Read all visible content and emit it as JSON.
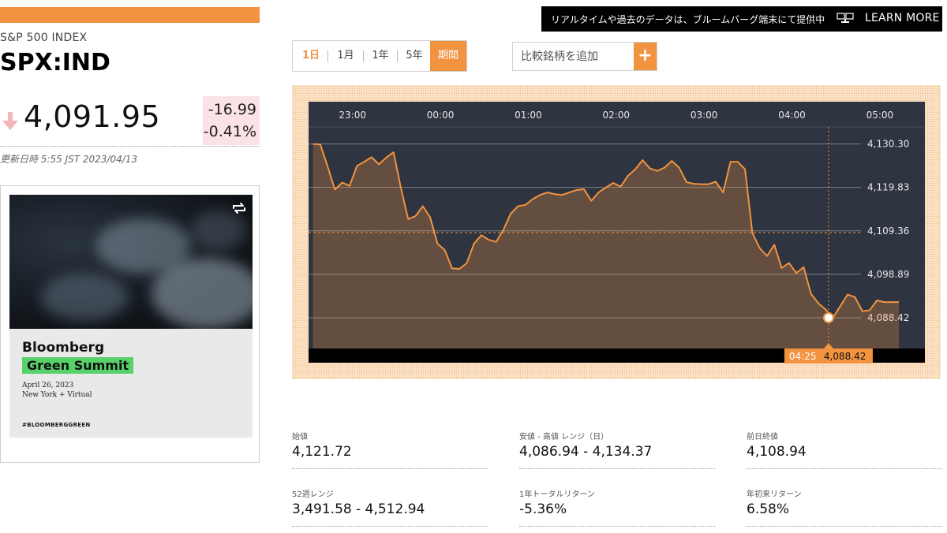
{
  "index": {
    "name": "S&P 500 INDEX",
    "ticker": "SPX:IND",
    "price": "4,091.95",
    "change_abs": "-16.99",
    "change_pct": "-0.41%",
    "updated": "更新日時 5:55 JST 2023/04/13",
    "direction": "down",
    "down_color": "#f4b6bb"
  },
  "promo": {
    "text": "リアルタイムや過去のデータは、ブルームバーグ端末にて提供中",
    "link": "LEARN MORE"
  },
  "range_tabs": [
    {
      "label": "1日",
      "active": true
    },
    {
      "label": "1月",
      "active": false
    },
    {
      "label": "1年",
      "active": false
    },
    {
      "label": "5年",
      "active": false
    },
    {
      "label": "期間",
      "active": false
    }
  ],
  "compare": {
    "placeholder": "比較銘柄を追加",
    "add_icon": "plus-icon"
  },
  "ad": {
    "brand": "Bloomberg",
    "event": "Green Summit",
    "date": "April 26, 2023",
    "location": "New York + Virtual",
    "hashtag": "#BLOOMBERGGREEN",
    "replay_icon": "replay-icon"
  },
  "chart_data": {
    "type": "line",
    "x_ticks": [
      "23:00",
      "00:00",
      "01:00",
      "02:00",
      "03:00",
      "04:00",
      "05:00"
    ],
    "y_ticks": [
      "4,130.30",
      "4,119.83",
      "4,109.36",
      "4,098.89",
      "4,088.42"
    ],
    "previous_close": 4108.94,
    "x": [
      "22:33",
      "22:38",
      "22:43",
      "22:48",
      "22:53",
      "22:58",
      "23:03",
      "23:08",
      "23:13",
      "23:18",
      "23:23",
      "23:28",
      "23:33",
      "23:38",
      "23:43",
      "23:48",
      "23:53",
      "23:58",
      "00:03",
      "00:08",
      "00:13",
      "00:18",
      "00:23",
      "00:28",
      "00:33",
      "00:38",
      "00:43",
      "00:48",
      "00:53",
      "00:58",
      "01:03",
      "01:08",
      "01:13",
      "01:18",
      "01:23",
      "01:28",
      "01:33",
      "01:38",
      "01:43",
      "01:48",
      "01:53",
      "01:58",
      "02:03",
      "02:08",
      "02:13",
      "02:18",
      "02:23",
      "02:28",
      "02:33",
      "02:38",
      "02:43",
      "02:48",
      "02:53",
      "02:58",
      "03:03",
      "03:08",
      "03:13",
      "03:18",
      "03:23",
      "03:28",
      "03:33",
      "03:38",
      "03:43",
      "03:48",
      "03:53",
      "03:58",
      "04:03",
      "04:08",
      "04:13",
      "04:18",
      "04:23",
      "04:28",
      "04:33",
      "04:38",
      "04:43",
      "04:48",
      "04:53",
      "04:58",
      "05:03",
      "05:08",
      "05:13"
    ],
    "values": [
      4130.3,
      4130.2,
      4124.9,
      4119.3,
      4121.0,
      4120.2,
      4125.0,
      4126.0,
      4127.1,
      4125.4,
      4127.0,
      4128.3,
      4119.8,
      4112.2,
      4112.9,
      4115.3,
      4112.6,
      4106.3,
      4104.7,
      4100.3,
      4100.2,
      4101.6,
      4106.3,
      4108.3,
      4107.2,
      4106.7,
      4109.6,
      4113.5,
      4115.3,
      4115.6,
      4117.0,
      4118.0,
      4118.6,
      4118.2,
      4118.0,
      4118.6,
      4119.2,
      4119.4,
      4116.6,
      4118.6,
      4119.8,
      4120.9,
      4120.0,
      4122.6,
      4124.2,
      4126.4,
      4124.4,
      4123.8,
      4124.6,
      4126.2,
      4124.6,
      4121.1,
      4120.7,
      4120.6,
      4120.6,
      4121.2,
      4118.6,
      4126.0,
      4126.0,
      4124.2,
      4108.8,
      4105.2,
      4103.3,
      4106.0,
      4100.4,
      4101.6,
      4099.2,
      4100.6,
      4094.2,
      4091.9,
      4090.4,
      4088.42,
      4091.2,
      4094.0,
      4093.4,
      4090.0,
      4090.2,
      4092.6,
      4092.2,
      4092.2,
      4092.2
    ],
    "xlabel": "",
    "ylabel": "",
    "ylim": [
      4081,
      4134.4
    ],
    "grid": true,
    "tooltip": {
      "time": "04:25",
      "value": "4,088.42"
    },
    "line_color": "#f2933f",
    "bg_color": "#2e3440"
  },
  "stats": [
    {
      "label": "始値",
      "value": "4,121.72"
    },
    {
      "label": "安値 - 高値 レンジ（日）",
      "value": "4,086.94 - 4,134.37"
    },
    {
      "label": "前日終値",
      "value": "4,108.94"
    },
    {
      "label": "52週レンジ",
      "value": "3,491.58 - 4,512.94"
    },
    {
      "label": "1年トータルリターン",
      "value": "-5.36%"
    },
    {
      "label": "年初来リターン",
      "value": "6.58%"
    }
  ],
  "accent_color": "#f2933f"
}
